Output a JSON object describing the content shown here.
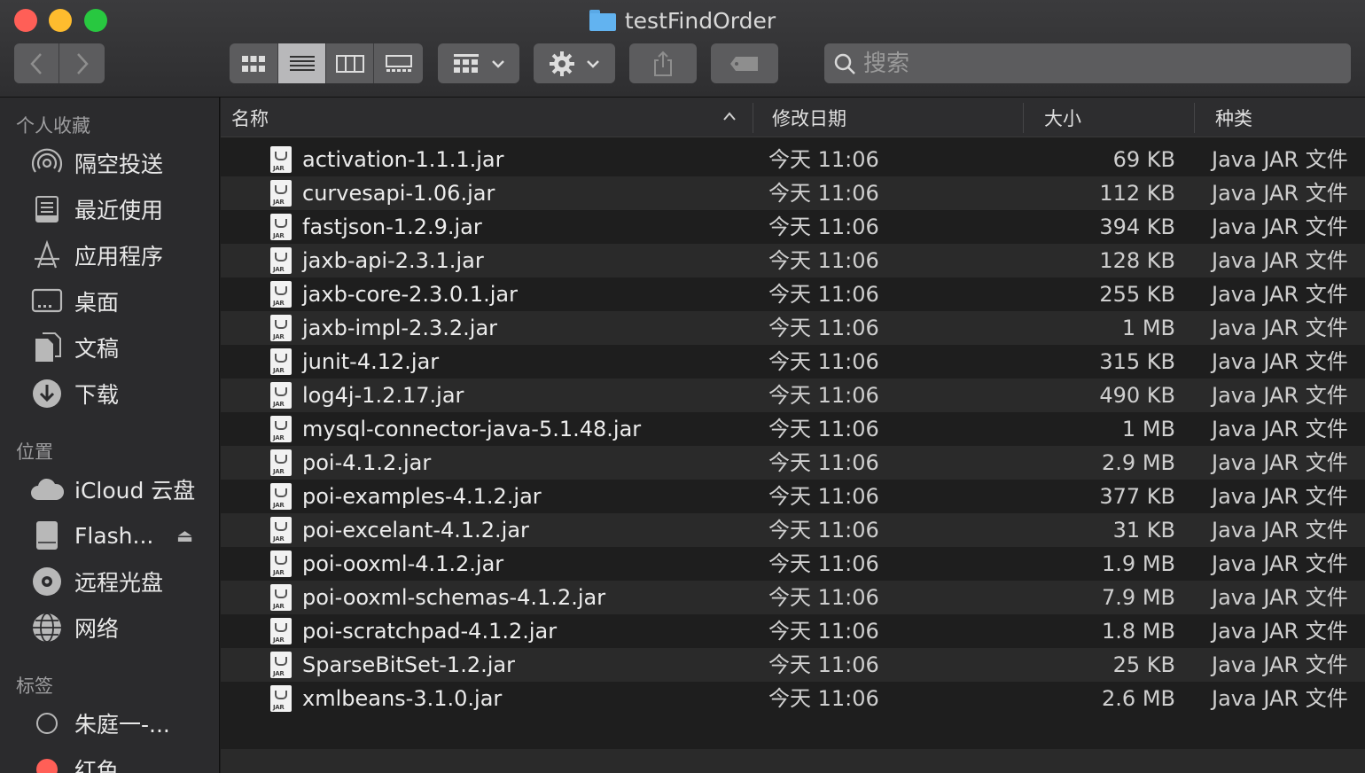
{
  "window": {
    "title": "testFindOrder"
  },
  "toolbar": {
    "search_placeholder": "搜索",
    "back_icon": "chevron-left-icon",
    "forward_icon": "chevron-right-icon"
  },
  "sidebar": {
    "sections": {
      "favorites": "个人收藏",
      "locations": "位置",
      "tags": "标签"
    },
    "favorites": [
      {
        "label": "隔空投送",
        "icon": "airdrop-icon"
      },
      {
        "label": "最近使用",
        "icon": "recents-icon"
      },
      {
        "label": "应用程序",
        "icon": "applications-icon"
      },
      {
        "label": "桌面",
        "icon": "desktop-icon"
      },
      {
        "label": "文稿",
        "icon": "documents-icon"
      },
      {
        "label": "下载",
        "icon": "downloads-icon"
      }
    ],
    "locations": [
      {
        "label": "iCloud 云盘",
        "icon": "cloud-icon"
      },
      {
        "label": "Flash...",
        "icon": "drive-icon"
      },
      {
        "label": "远程光盘",
        "icon": "disc-icon"
      },
      {
        "label": "网络",
        "icon": "globe-icon"
      }
    ],
    "tags": [
      {
        "label": "朱庭一-...",
        "color": "#2b2b2d"
      },
      {
        "label": "红色",
        "color": "#ff5f57"
      }
    ]
  },
  "columns": {
    "name": "名称",
    "date": "修改日期",
    "size": "大小",
    "kind": "种类"
  },
  "files": [
    {
      "name": "activation-1.1.1.jar",
      "date": "今天 11:06",
      "size": "69 KB",
      "kind": "Java JAR 文件"
    },
    {
      "name": "curvesapi-1.06.jar",
      "date": "今天 11:06",
      "size": "112 KB",
      "kind": "Java JAR 文件"
    },
    {
      "name": "fastjson-1.2.9.jar",
      "date": "今天 11:06",
      "size": "394 KB",
      "kind": "Java JAR 文件"
    },
    {
      "name": "jaxb-api-2.3.1.jar",
      "date": "今天 11:06",
      "size": "128 KB",
      "kind": "Java JAR 文件"
    },
    {
      "name": "jaxb-core-2.3.0.1.jar",
      "date": "今天 11:06",
      "size": "255 KB",
      "kind": "Java JAR 文件"
    },
    {
      "name": "jaxb-impl-2.3.2.jar",
      "date": "今天 11:06",
      "size": "1 MB",
      "kind": "Java JAR 文件"
    },
    {
      "name": "junit-4.12.jar",
      "date": "今天 11:06",
      "size": "315 KB",
      "kind": "Java JAR 文件"
    },
    {
      "name": "log4j-1.2.17.jar",
      "date": "今天 11:06",
      "size": "490 KB",
      "kind": "Java JAR 文件"
    },
    {
      "name": "mysql-connector-java-5.1.48.jar",
      "date": "今天 11:06",
      "size": "1 MB",
      "kind": "Java JAR 文件"
    },
    {
      "name": "poi-4.1.2.jar",
      "date": "今天 11:06",
      "size": "2.9 MB",
      "kind": "Java JAR 文件"
    },
    {
      "name": "poi-examples-4.1.2.jar",
      "date": "今天 11:06",
      "size": "377 KB",
      "kind": "Java JAR 文件"
    },
    {
      "name": "poi-excelant-4.1.2.jar",
      "date": "今天 11:06",
      "size": "31 KB",
      "kind": "Java JAR 文件"
    },
    {
      "name": "poi-ooxml-4.1.2.jar",
      "date": "今天 11:06",
      "size": "1.9 MB",
      "kind": "Java JAR 文件"
    },
    {
      "name": "poi-ooxml-schemas-4.1.2.jar",
      "date": "今天 11:06",
      "size": "7.9 MB",
      "kind": "Java JAR 文件"
    },
    {
      "name": "poi-scratchpad-4.1.2.jar",
      "date": "今天 11:06",
      "size": "1.8 MB",
      "kind": "Java JAR 文件"
    },
    {
      "name": "SparseBitSet-1.2.jar",
      "date": "今天 11:06",
      "size": "25 KB",
      "kind": "Java JAR 文件"
    },
    {
      "name": "xmlbeans-3.1.0.jar",
      "date": "今天 11:06",
      "size": "2.6 MB",
      "kind": "Java JAR 文件"
    }
  ],
  "file_icon_label": "JAR"
}
